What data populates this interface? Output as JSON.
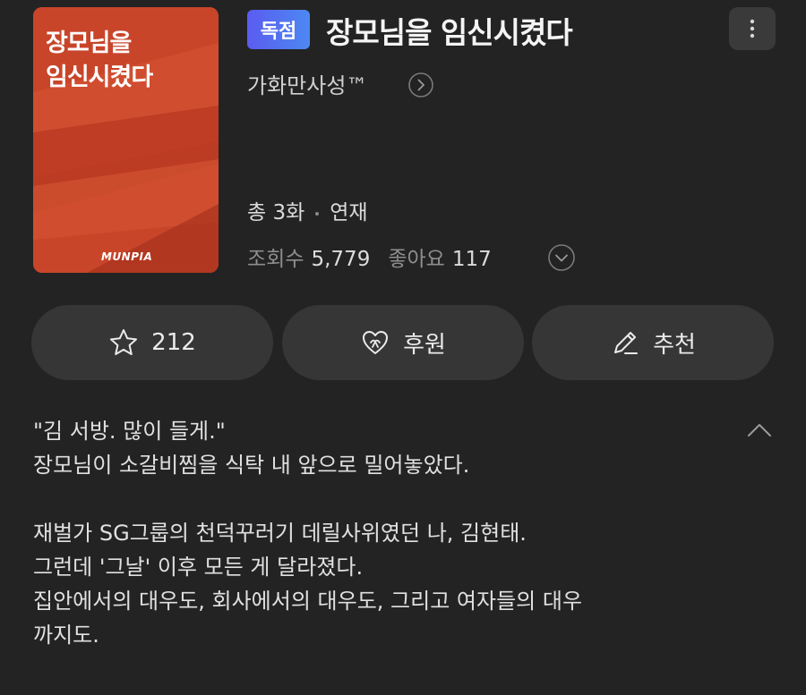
{
  "cover": {
    "title": "장모님을\n임신시켰다",
    "brand": "MUNPIA"
  },
  "header": {
    "badge": "독점",
    "title": "장모님을 임신시켰다",
    "author": "가화만사성™"
  },
  "info": {
    "episodes": "총 3화",
    "status": "연재",
    "views_label": "조회수",
    "views": "5,779",
    "likes_label": "좋아요",
    "likes": "117"
  },
  "actions": {
    "bookmark_count": "212",
    "support_label": "후원",
    "recommend_label": "추천"
  },
  "synopsis": {
    "lines": [
      "\"김 서방. 많이 들게.\"",
      "장모님이 소갈비찜을 식탁 내 앞으로 밀어놓았다.",
      "",
      "재벌가 SG그룹의 천덕꾸러기 데릴사위였던 나, 김현태.",
      "그런데 '그날' 이후 모든 게 달라졌다.",
      "집안에서의 대우도, 회사에서의 대우도, 그리고 여자들의 대우",
      "까지도."
    ]
  },
  "colors": {
    "background": "#232323",
    "badge_start": "#5a5cf0",
    "badge_end": "#4d88f2",
    "cover": "#c8452a",
    "button": "#363636"
  }
}
